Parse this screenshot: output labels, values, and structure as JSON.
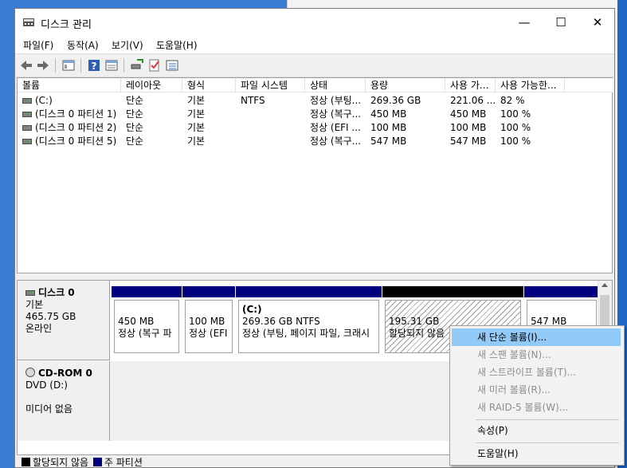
{
  "window": {
    "title": "디스크 관리",
    "controls": {
      "minimize": "—",
      "maximize": "☐",
      "close": "✕"
    }
  },
  "menu": [
    "파일(F)",
    "동작(A)",
    "보기(V)",
    "도움말(H)"
  ],
  "toolbar": [
    "back-icon",
    "forward-icon",
    "console-tree-icon",
    "help-icon",
    "properties-icon",
    "disk-connect-icon",
    "check-icon",
    "list-view-icon"
  ],
  "volume_list": {
    "columns": [
      "볼륨",
      "레이아웃",
      "형식",
      "파일 시스템",
      "상태",
      "용량",
      "사용 가...",
      "사용 가능한..."
    ],
    "rows": [
      [
        "(C:)",
        "단순",
        "기본",
        "NTFS",
        "정상 (부팅...",
        "269.36 GB",
        "221.06 ...",
        "82 %"
      ],
      [
        "(디스크 0 파티션 1)",
        "단순",
        "기본",
        "",
        "정상 (복구...",
        "450 MB",
        "450 MB",
        "100 %"
      ],
      [
        "(디스크 0 파티션 2)",
        "단순",
        "기본",
        "",
        "정상 (EFI ...",
        "100 MB",
        "100 MB",
        "100 %"
      ],
      [
        "(디스크 0 파티션 5)",
        "단순",
        "기본",
        "",
        "정상 (복구...",
        "547 MB",
        "547 MB",
        "100 %"
      ]
    ]
  },
  "disks": [
    {
      "name": "디스크 0",
      "type": "기본",
      "size": "465.75 GB",
      "status": "온라인",
      "partitions": [
        {
          "title": "",
          "size": "450 MB",
          "desc": "정상 (복구 파"
        },
        {
          "title": "",
          "size": "100 MB",
          "desc": "정상 (EFI"
        },
        {
          "title": "(C:)",
          "size": "269.36 GB NTFS",
          "desc": "정상 (부팅, 페이지 파일, 크래시"
        },
        {
          "title": "",
          "size": "195.31 GB",
          "desc": "할당되지 않음"
        },
        {
          "title": "",
          "size": "547 MB",
          "desc": ""
        }
      ]
    },
    {
      "name": "CD-ROM 0",
      "type": "DVD (D:)",
      "status": "미디어 없음"
    }
  ],
  "legend": [
    {
      "label": "할당되지 않음",
      "color": "#000000"
    },
    {
      "label": "주 파티션",
      "color": "#00007f"
    }
  ],
  "context_menu": {
    "items": [
      {
        "label": "새 단순 볼륨(I)...",
        "state": "highlighted"
      },
      {
        "label": "새 스팬 볼륨(N)...",
        "state": "disabled"
      },
      {
        "label": "새 스트라이프 볼륨(T)...",
        "state": "disabled"
      },
      {
        "label": "새 미러 볼륨(R)...",
        "state": "disabled"
      },
      {
        "label": "새 RAID-5 볼륨(W)...",
        "state": "disabled"
      },
      {
        "label": "속성(P)",
        "state": "enabled"
      },
      {
        "label": "도움말(H)",
        "state": "enabled"
      }
    ]
  },
  "colors": {
    "primary_partition": "#00007f",
    "unallocated": "#000000",
    "menu_highlight": "#91c9f7"
  }
}
